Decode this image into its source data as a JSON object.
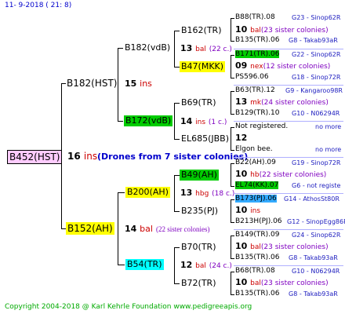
{
  "header": {
    "date": "11-  9-2018 ( 21:  8)"
  },
  "footer": {
    "copyright": "Copyright 2004-2018 @ Karl Kehrle Foundation    www.pedigreeapis.org"
  },
  "root": {
    "name": "B452(HST)",
    "num": "16",
    "suffix": "ins",
    "note": "(Drones from 7 sister colonies)"
  },
  "gen1": [
    {
      "name": "B182(HST)",
      "num": "15",
      "suffix": "ins"
    },
    {
      "name": "B152(AH)",
      "num": "14",
      "suffix": "bal",
      "note": "(22 sister colonies)"
    }
  ],
  "gen2": [
    {
      "name": "B182(vdB)",
      "num": "13",
      "suffix": "bal",
      "note": "(22 c.)"
    },
    {
      "name": "B172(vdB)",
      "num": "14",
      "suffix": "ins",
      "note": "(1 c.)"
    },
    {
      "name": "B200(AH)",
      "num": "13",
      "suffix": "hbg",
      "note": "(18 c.)"
    },
    {
      "name": "B54(TR)",
      "num": "12",
      "suffix": "bal",
      "note": "(24 c.)"
    }
  ],
  "gen3": [
    {
      "name": "B162(TR)",
      "num": "10",
      "suffix": "bal",
      "note": "(23 sister colonies)"
    },
    {
      "name": "B47(MKK)",
      "num": "09",
      "suffix": "nex",
      "note": "(12 sister colonies)"
    },
    {
      "name": "B69(TR)",
      "num": "13",
      "suffix": "mk",
      "note": "(24 sister colonies)"
    },
    {
      "name": "EL685(JBB)",
      "num": "12",
      "suffix": "",
      "note": ""
    },
    {
      "name": "B49(AH)",
      "num": "10",
      "suffix": "hb",
      "note": "(22 sister colonies)"
    },
    {
      "name": "B235(PJ)",
      "num": "10",
      "suffix": "ins",
      "note": ""
    },
    {
      "name": "B70(TR)",
      "num": "10",
      "suffix": "bal",
      "note": "(23 sister colonies)"
    },
    {
      "name": "B72(TR)",
      "num": "10",
      "suffix": "bal",
      "note": "(23 sister colonies)"
    }
  ],
  "gen4": [
    {
      "name": "B88(TR).08",
      "right": "G23 - Sinop62R"
    },
    {
      "name": "B135(TR).06",
      "right": "G8 - Takab93aR"
    },
    {
      "name": "B171(TR).06",
      "right": "G22 - Sinop62R"
    },
    {
      "name": "PS596.06",
      "right": "G18 - Sinop72R"
    },
    {
      "name": "B63(TR).12",
      "right": "G9 - Kangaroo98R"
    },
    {
      "name": "B129(TR).10",
      "right": "G10 - N06294R"
    },
    {
      "name": "Not registered.",
      "right": "no more"
    },
    {
      "name": "Elgon bee.",
      "right": "no more"
    },
    {
      "name": "B22(AH).09",
      "right": "G19 - Sinop72R"
    },
    {
      "name": "EL74(KK).07",
      "right": "G6 - not registe"
    },
    {
      "name": "B173(PJ).06",
      "right": "G14 - AthosSt80R"
    },
    {
      "name": "B213H(PJ).06",
      "right": "G12 - SinopEgg86R"
    },
    {
      "name": "B149(TR).09",
      "right": "G24 - Sinop62R"
    },
    {
      "name": "B135(TR).06",
      "right": "G8 - Takab93aR"
    },
    {
      "name": "B68(TR).08",
      "right": "G10 - N06294R"
    },
    {
      "name": "B135(TR).06",
      "right": "G8 - Takab93aR"
    }
  ],
  "colors": {
    "root_bg": "#ffccff",
    "green": "#00cc00",
    "yellow": "#ffff00",
    "cyan": "#00ffff",
    "blue": "#33aaff"
  }
}
